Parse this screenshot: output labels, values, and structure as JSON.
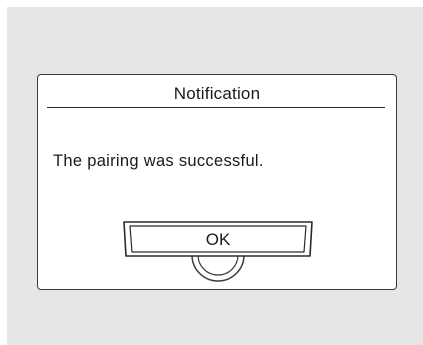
{
  "dialog": {
    "title": "Notification",
    "message": "The pairing was successful.",
    "ok_label": "OK"
  },
  "colors": {
    "screen_background": "#e6e6e6",
    "dialog_background": "#ffffff",
    "border": "#3a3a3a",
    "text": "#1a1a1a"
  },
  "icons": {
    "ok_button_knob": "rotary-knob-icon"
  }
}
